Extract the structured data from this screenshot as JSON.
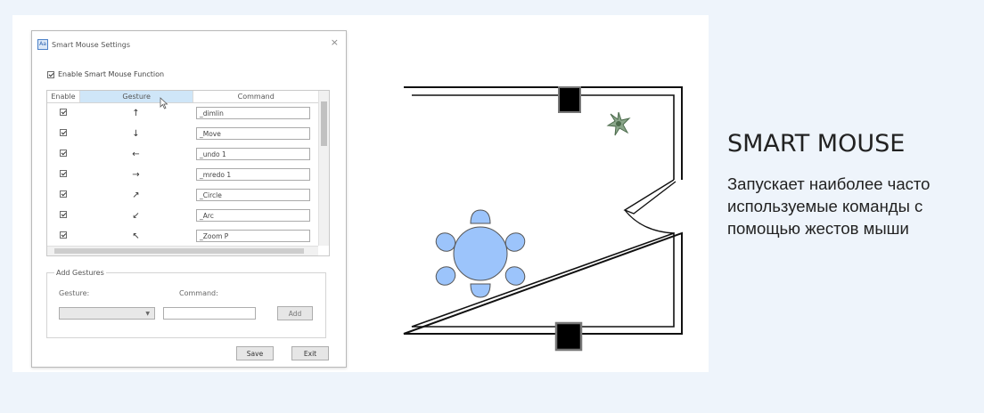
{
  "dialog": {
    "title": "Smart Mouse Settings",
    "close": "×",
    "app_icon": "Aa",
    "enable_label": "Enable Smart Mouse Function",
    "enable_checked": true,
    "columns": [
      "Enable",
      "Gesture",
      "Command"
    ],
    "rows": [
      {
        "enabled": true,
        "gesture": "↑",
        "command": "_dimlin"
      },
      {
        "enabled": true,
        "gesture": "↓",
        "command": "_Move"
      },
      {
        "enabled": true,
        "gesture": "←",
        "command": "_undo 1"
      },
      {
        "enabled": true,
        "gesture": "→",
        "command": "_mredo 1"
      },
      {
        "enabled": true,
        "gesture": "↗",
        "command": "_Circle"
      },
      {
        "enabled": true,
        "gesture": "↙",
        "command": "_Arc"
      },
      {
        "enabled": true,
        "gesture": "↖",
        "command": "_Zoom P"
      }
    ],
    "add_gestures": {
      "title": "Add Gestures",
      "gesture_label": "Gesture:",
      "command_label": "Command:",
      "add_button": "Add"
    },
    "save_button": "Save",
    "exit_button": "Exit"
  },
  "feature": {
    "title": "SMART MOUSE",
    "description": "Запускает наиболее часто используемые команды с помощью жестов мыши"
  },
  "colors": {
    "background": "#eef4fb",
    "furniture": "#9cc4fb",
    "selected_header": "#cfe6f8"
  }
}
